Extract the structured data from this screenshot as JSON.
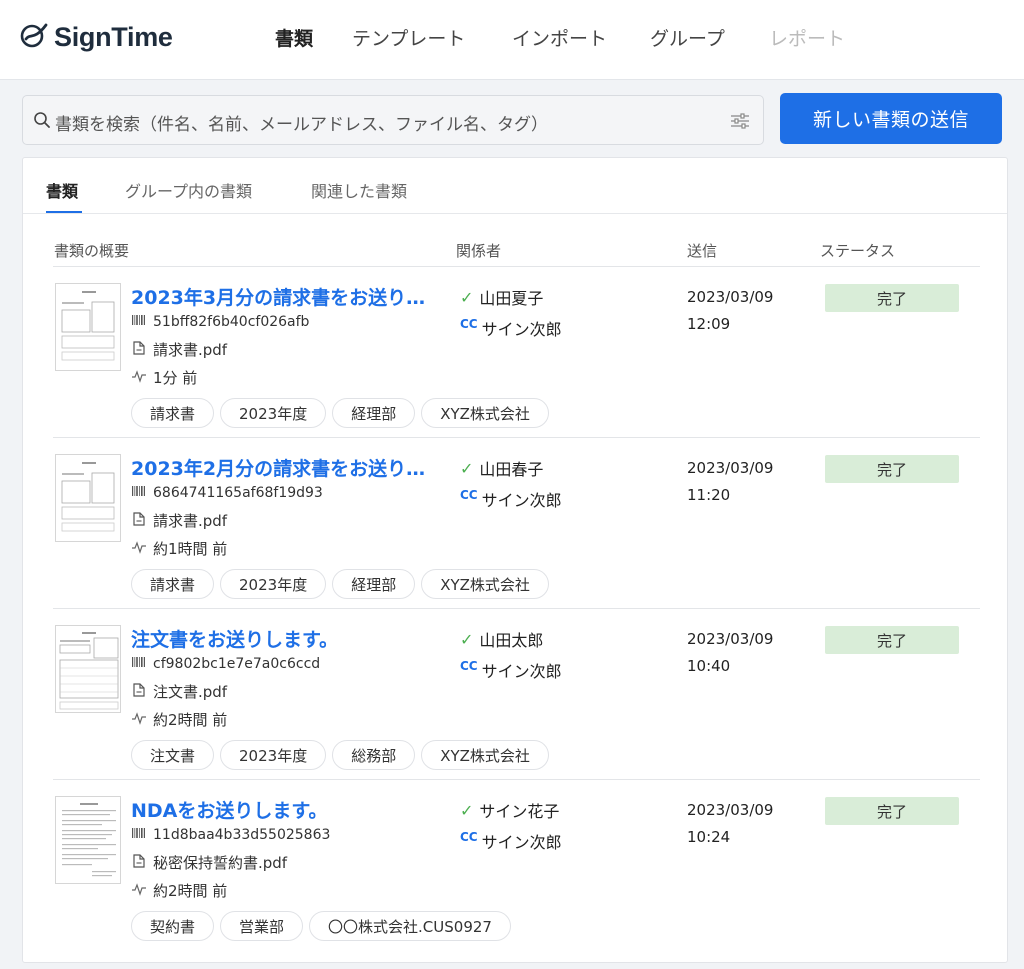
{
  "app": {
    "name": "SignTime"
  },
  "nav": [
    "書類",
    "テンプレート",
    "インポート",
    "グループ",
    "レポート"
  ],
  "search": {
    "placeholder": "書類を検索（件名、名前、メールアドレス、ファイル名、タグ）"
  },
  "send_button": "新しい書類の送信",
  "tabs": [
    "書類",
    "グループ内の書類",
    "関連した書類"
  ],
  "columns": [
    "書類の概要",
    "関係者",
    "送信",
    "ステータス"
  ],
  "documents": [
    {
      "title": "2023年3月分の請求書をお送り…",
      "id": "51bff82f6b40cf026afb",
      "file": "請求書.pdf",
      "activity": "1分 前",
      "tags": [
        "請求書",
        "2023年度",
        "経理部",
        "XYZ株式会社"
      ],
      "signer": "山田夏子",
      "cc": "サイン次郎",
      "sent_date": "2023/03/09",
      "sent_time": "12:09",
      "status": "完了"
    },
    {
      "title": "2023年2月分の請求書をお送り…",
      "id": "6864741165af68f19d93",
      "file": "請求書.pdf",
      "activity": "約1時間 前",
      "tags": [
        "請求書",
        "2023年度",
        "経理部",
        "XYZ株式会社"
      ],
      "signer": "山田春子",
      "cc": "サイン次郎",
      "sent_date": "2023/03/09",
      "sent_time": "11:20",
      "status": "完了"
    },
    {
      "title": "注文書をお送りします。",
      "id": "cf9802bc1e7e7a0c6ccd",
      "file": "注文書.pdf",
      "activity": "約2時間 前",
      "tags": [
        "注文書",
        "2023年度",
        "総務部",
        "XYZ株式会社"
      ],
      "signer": "山田太郎",
      "cc": "サイン次郎",
      "sent_date": "2023/03/09",
      "sent_time": "10:40",
      "status": "完了"
    },
    {
      "title": "NDAをお送りします。",
      "id": "11d8baa4b33d55025863",
      "file": "秘密保持誓約書.pdf",
      "activity": "約2時間 前",
      "tags": [
        "契約書",
        "営業部",
        "〇〇株式会社.CUS0927"
      ],
      "signer": "サイン花子",
      "cc": "サイン次郎",
      "sent_date": "2023/03/09",
      "sent_time": "10:24",
      "status": "完了"
    }
  ],
  "colors": {
    "accent": "#1e6fe6",
    "status_done": "#d9edd8",
    "check": "#4caf50"
  },
  "icons": [
    "signtime-logo-icon",
    "search-icon",
    "filter-sliders-icon",
    "barcode-icon",
    "file-icon",
    "activity-icon",
    "check-icon"
  ]
}
